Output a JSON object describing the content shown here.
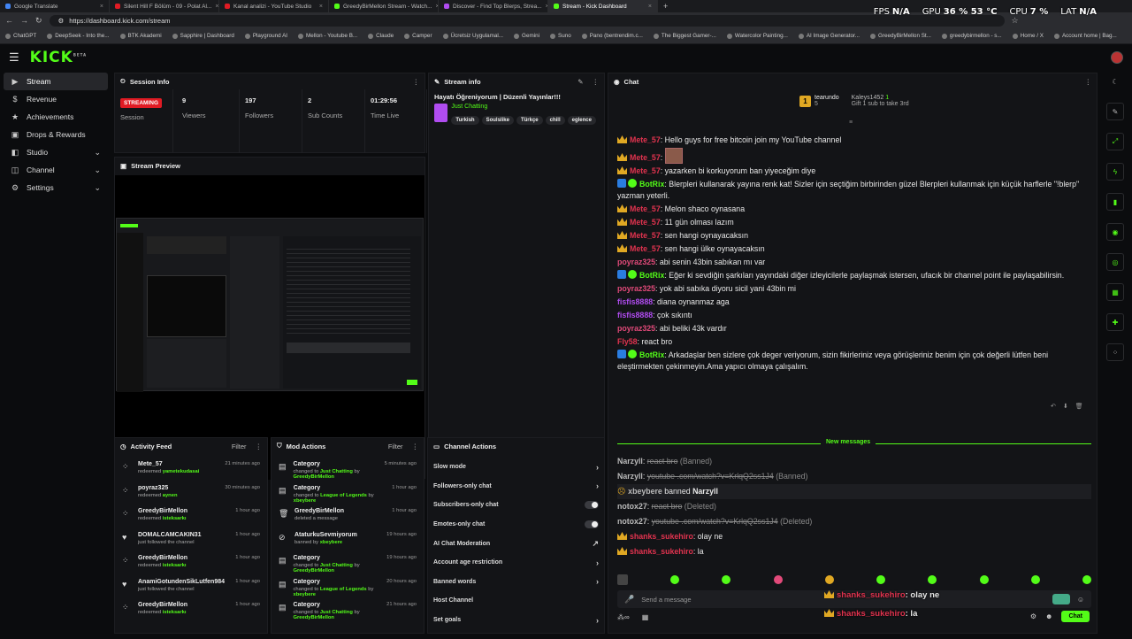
{
  "browser": {
    "tabs": [
      {
        "label": "Google Translate",
        "color": "#4285f4"
      },
      {
        "label": "Silent Hill F Bölüm - 09 - Polat Al...",
        "color": "#e01b24"
      },
      {
        "label": "Kanal analizi - YouTube Studio",
        "color": "#e01b24"
      },
      {
        "label": "GreedyBirMellon Stream - Watch...",
        "color": "#53fc18"
      },
      {
        "label": "Discover - Find Top Blerps, Strea...",
        "color": "#b04cf0"
      },
      {
        "label": "Stream - Kick Dashboard",
        "color": "#53fc18"
      }
    ],
    "url": "https://dashboard.kick.com/stream",
    "bookmarks": [
      "ChatGPT",
      "DeepSeek - Into the...",
      "BTK Akademi",
      "Sapphire | Dashboard",
      "Playground AI",
      "Mellon - Youtube B...",
      "Claude",
      "Camper",
      "Ücretsiz Uygulamal...",
      "Gemini",
      "Suno",
      "Pano (bentrendim.c...",
      "The Biggest Gamer-...",
      "Watercolor Painting...",
      "AI Image Generator...",
      "GreedyBirMellon St...",
      "greedybirmellon - s...",
      "Home / X",
      "Account home | Bag..."
    ]
  },
  "overlay": [
    {
      "k": "FPS",
      "v": "N/A"
    },
    {
      "k": "GPU",
      "v": "36 % 53 °C"
    },
    {
      "k": "CPU",
      "v": "7 %"
    },
    {
      "k": "LAT",
      "v": "N/A"
    }
  ],
  "app": {
    "logo": "KICK",
    "logo_beta": "BETA"
  },
  "sidebar": [
    {
      "label": "Stream",
      "icon": "stream-icon",
      "glyph": "▶",
      "active": true
    },
    {
      "label": "Revenue",
      "icon": "dollar-icon",
      "glyph": "$"
    },
    {
      "label": "Achievements",
      "icon": "trophy-icon",
      "glyph": "★"
    },
    {
      "label": "Drops & Rewards",
      "icon": "gift-icon",
      "glyph": "▣"
    },
    {
      "label": "Studio",
      "icon": "studio-icon",
      "glyph": "◧",
      "chev": "⌄"
    },
    {
      "label": "Channel",
      "icon": "channel-icon",
      "glyph": "◫",
      "chev": "⌄"
    },
    {
      "label": "Settings",
      "icon": "gear-icon",
      "glyph": "⚙",
      "chev": "⌄"
    }
  ],
  "session": {
    "title": "Session Info",
    "status": "STREAMING",
    "status_label": "Session",
    "stats": [
      {
        "value": "9",
        "label": "Viewers"
      },
      {
        "value": "197",
        "label": "Followers"
      },
      {
        "value": "2",
        "label": "Sub Counts"
      },
      {
        "value": "01:29:56",
        "label": "Time Live"
      }
    ]
  },
  "preview": {
    "title": "Stream Preview"
  },
  "streaminfo": {
    "title": "Stream info",
    "stream_title": "Hayatı Öğreniyorum | Düzenli Yayınlar!!!",
    "category": "Just Chatting",
    "tags": [
      "Turkish",
      "Soulslike",
      "Türkçe",
      "chill",
      "eglence"
    ]
  },
  "activity": {
    "title": "Activity Feed",
    "filter": "Filter",
    "items": [
      {
        "user": "Mete_57",
        "action": "redeemed",
        "target": "yametekudasai",
        "time": "21 minutes ago",
        "icon": "redeem-icon",
        "glyph": "⁘"
      },
      {
        "user": "poyraz325",
        "action": "redeemed",
        "target": "aynen",
        "time": "30 minutes ago",
        "icon": "redeem-icon",
        "glyph": "⁘"
      },
      {
        "user": "GreedyBirMellon",
        "action": "redeemed",
        "target": "isteksarkı",
        "time": "1 hour ago",
        "icon": "redeem-icon",
        "glyph": "⁘"
      },
      {
        "user": "DOMALCAMCAKIN31",
        "action": "just followed the channel",
        "target": "",
        "time": "1 hour ago",
        "icon": "heart-icon",
        "glyph": "♥"
      },
      {
        "user": "GreedyBirMellon",
        "action": "redeemed",
        "target": "isteksarkı",
        "time": "1 hour ago",
        "icon": "redeem-icon",
        "glyph": "⁘"
      },
      {
        "user": "AnamiGotundenSikLutfen984",
        "action": "just followed the channel",
        "target": "",
        "time": "1 hour ago",
        "icon": "heart-icon",
        "glyph": "♥"
      },
      {
        "user": "GreedyBirMellon",
        "action": "redeemed",
        "target": "isteksarkı",
        "time": "1 hour ago",
        "icon": "redeem-icon",
        "glyph": "⁘"
      }
    ]
  },
  "mod": {
    "title": "Mod Actions",
    "filter": "Filter",
    "items": [
      {
        "title": "Category",
        "line_pre": "changed to",
        "hl": "Just Chatting",
        "by": "by",
        "byuser": "GreedyBirMellon",
        "time": "5 minutes ago",
        "icon": "category-icon",
        "glyph": "▤"
      },
      {
        "title": "Category",
        "line_pre": "changed to",
        "hl": "League of Legends",
        "by": "by",
        "byuser": "xbeybere",
        "time": "1 hour ago",
        "icon": "category-icon",
        "glyph": "▤"
      },
      {
        "title": "GreedyBirMellon",
        "line_pre": "deleted a message",
        "hl": "",
        "by": "",
        "byuser": "",
        "time": "1 hour ago",
        "icon": "trash-icon",
        "glyph": "🗑"
      },
      {
        "title": "AtaturkuSevmiyorum",
        "line_pre": "banned by",
        "hl": "xbeybere",
        "by": "",
        "byuser": "",
        "time": "19 hours ago",
        "icon": "ban-icon",
        "glyph": "⊘"
      },
      {
        "title": "Category",
        "line_pre": "changed to",
        "hl": "Just Chatting",
        "by": "by",
        "byuser": "GreedyBirMellon",
        "time": "19 hours ago",
        "icon": "category-icon",
        "glyph": "▤"
      },
      {
        "title": "Category",
        "line_pre": "changed to",
        "hl": "League of Legends",
        "by": "by",
        "byuser": "xbeybere",
        "time": "20 hours ago",
        "icon": "category-icon",
        "glyph": "▤"
      },
      {
        "title": "Category",
        "line_pre": "changed to",
        "hl": "Just Chatting",
        "by": "by",
        "byuser": "GreedyBirMellon",
        "time": "21 hours ago",
        "icon": "category-icon",
        "glyph": "▤"
      }
    ]
  },
  "channel_actions": {
    "title": "Channel Actions",
    "items": [
      {
        "label": "Slow mode",
        "kind": "chev"
      },
      {
        "label": "Followers-only chat",
        "kind": "chev"
      },
      {
        "label": "Subscribers-only chat",
        "kind": "toggle"
      },
      {
        "label": "Emotes-only chat",
        "kind": "toggle"
      },
      {
        "label": "AI Chat Moderation",
        "kind": "ext"
      },
      {
        "label": "Account age restriction",
        "kind": "chev"
      },
      {
        "label": "Banned words",
        "kind": "chev"
      },
      {
        "label": "Host Channel",
        "kind": "none"
      },
      {
        "label": "Set goals",
        "kind": "chev"
      }
    ]
  },
  "chat": {
    "title": "Chat",
    "leader": {
      "rank": "1",
      "name": "tearundo",
      "count": "5",
      "name2": "Kaleys1452",
      "count2": "1",
      "gift_text": "Gift 1 sub to take 3rd"
    },
    "new_messages": "New messages",
    "placeholder": "Send a message",
    "send": "Chat",
    "overlay_msgs": [
      {
        "user": "shanks_sukehiro",
        "text": ": olay ne"
      },
      {
        "user": "shanks_sukehiro",
        "text": ": la"
      }
    ],
    "messages": [
      {
        "badge": "crown",
        "user": "Mete_57",
        "color": "red",
        "text": ": Hello guys for free bitcoin join my YouTube channel"
      },
      {
        "badge": "crown",
        "user": "Mete_57",
        "color": "red",
        "text": ":",
        "emote": true
      },
      {
        "badge": "crown",
        "user": "Mete_57",
        "color": "red",
        "text": ": yazarken bi korkuyorum ban yiyeceğim diye"
      },
      {
        "badge": "bot",
        "user": "BotRix",
        "color": "grn",
        "text": ": Blerpleri kullanarak yayına renk kat! Sizler için seçtiğim birbirinden güzel Blerpleri kullanmak için küçük harflerle \"!blerp\" yazman yeterli."
      },
      {
        "badge": "crown",
        "user": "Mete_57",
        "color": "red",
        "text": ": Melon shaco oynasana"
      },
      {
        "badge": "crown",
        "user": "Mete_57",
        "color": "red",
        "text": ": 11 gün olması lazım"
      },
      {
        "badge": "crown",
        "user": "Mete_57",
        "color": "red",
        "text": ": sen hangi oynayacaksın"
      },
      {
        "badge": "crown",
        "user": "Mete_57",
        "color": "red",
        "text": ": sen hangi ülke oynayacaksın"
      },
      {
        "badge": "",
        "user": "poyraz325",
        "color": "pink",
        "text": ": abi senin 43bin sabıkan mı var"
      },
      {
        "badge": "bot",
        "user": "BotRix",
        "color": "grn",
        "text": ": Eğer ki sevdiğin şarkıları yayındaki diğer izleyicilerle paylaşmak istersen, ufacık bir channel point ile paylaşabilirsin."
      },
      {
        "badge": "",
        "user": "poyraz325",
        "color": "pink",
        "text": ": yok abi sabıka diyoru sicil yani 43bin mi"
      },
      {
        "badge": "",
        "user": "fisfis8888",
        "color": "pur",
        "text": ": diana oynanmaz aga"
      },
      {
        "badge": "",
        "user": "fisfis8888",
        "color": "pur",
        "text": ": çok sıkıntı"
      },
      {
        "badge": "",
        "user": "poyraz325",
        "color": "pink",
        "text": ": abi beliki 43k vardır"
      },
      {
        "badge": "",
        "user": "Fly58",
        "color": "red",
        "text": ": react bro"
      },
      {
        "badge": "bot",
        "user": "BotRix",
        "color": "grn",
        "text": ": Arkadaşlar ben sizlere çok deger veriyorum, sizin fikirleriniz veya görüşleriniz benim için çok değerli lütfen beni eleştirmekten çekinmeyin.Ama yapıcı olmaya çalışalım."
      }
    ],
    "after": [
      {
        "type": "deleted",
        "user": "Narzyll",
        "text": "react bro",
        "suffix": " (Banned)"
      },
      {
        "type": "deleted",
        "user": "Narzyll",
        "text": "youtube .com/watch?v=KrlqQ2ss1J4",
        "suffix": " (Banned)"
      },
      {
        "type": "mod",
        "pre": "xbeybere",
        "mid": " banned ",
        "post": "Narzyll"
      },
      {
        "type": "deleted",
        "user": "notox27",
        "text": "react bro",
        "suffix": " (Deleted)"
      },
      {
        "type": "deleted",
        "user": "notox27",
        "text": "youtube .com/watch?v=KrlqQ2ss1J4",
        "suffix": " (Deleted)"
      },
      {
        "type": "normal",
        "user": "shanks_sukehiro",
        "text": ": olay ne"
      },
      {
        "type": "normal",
        "user": "shanks_sukehiro",
        "text": ": la"
      }
    ]
  },
  "rightbar": [
    {
      "icon": "moon-icon",
      "glyph": "☾"
    },
    {
      "icon": "pencil-icon",
      "glyph": "✎"
    },
    {
      "icon": "expand-icon",
      "glyph": "⤢"
    },
    {
      "icon": "bolt-icon",
      "glyph": "ϟ"
    },
    {
      "icon": "bookmark-icon",
      "glyph": "▮"
    },
    {
      "icon": "chat-bubble-icon",
      "glyph": "◉"
    },
    {
      "icon": "broadcast-icon",
      "glyph": "◎"
    },
    {
      "icon": "poll-icon",
      "glyph": "▦"
    },
    {
      "icon": "wrench-icon",
      "glyph": "✚"
    },
    {
      "icon": "apps-icon",
      "glyph": "⁘"
    }
  ]
}
